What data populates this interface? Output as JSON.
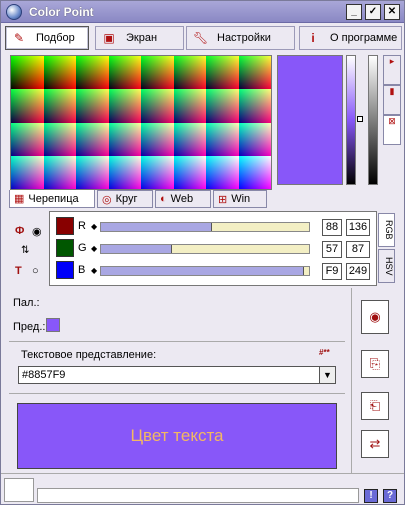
{
  "window": {
    "title": "Color Point"
  },
  "tabs": [
    {
      "label": "Подбор",
      "icon": "eyedropper-icon"
    },
    {
      "label": "Экран",
      "icon": "monitor-icon"
    },
    {
      "label": "Настройки",
      "icon": "wrench-icon"
    },
    {
      "label": "О программе",
      "icon": "info-icon"
    }
  ],
  "subtabs": [
    {
      "label": "Черепица",
      "icon": "tiles-icon"
    },
    {
      "label": "Круг",
      "icon": "circle-icon"
    },
    {
      "label": "Web",
      "icon": "web-icon"
    },
    {
      "label": "Win",
      "icon": "windows-icon"
    }
  ],
  "rgb": {
    "r": {
      "label": "R",
      "hex": "88",
      "dec": "136",
      "level": 0.533
    },
    "g": {
      "label": "G",
      "hex": "57",
      "dec": "87",
      "level": 0.341
    },
    "b": {
      "label": "B",
      "hex": "F9",
      "dec": "249",
      "level": 0.976
    }
  },
  "model_tabs": [
    "RGB",
    "HSV"
  ],
  "palette": {
    "pal_label": "Пал.:",
    "pred_label": "Пред.:"
  },
  "text_repr": {
    "label": "Текстовое представление:",
    "value": "#8857F9",
    "hash_marker": "#**"
  },
  "sample": {
    "text": "Цвет текста",
    "bg": "#8857F9",
    "fg": "#F3B862"
  },
  "colors": {
    "current": "#8857F9"
  },
  "status": {
    "help1": "!",
    "help2": "?"
  }
}
